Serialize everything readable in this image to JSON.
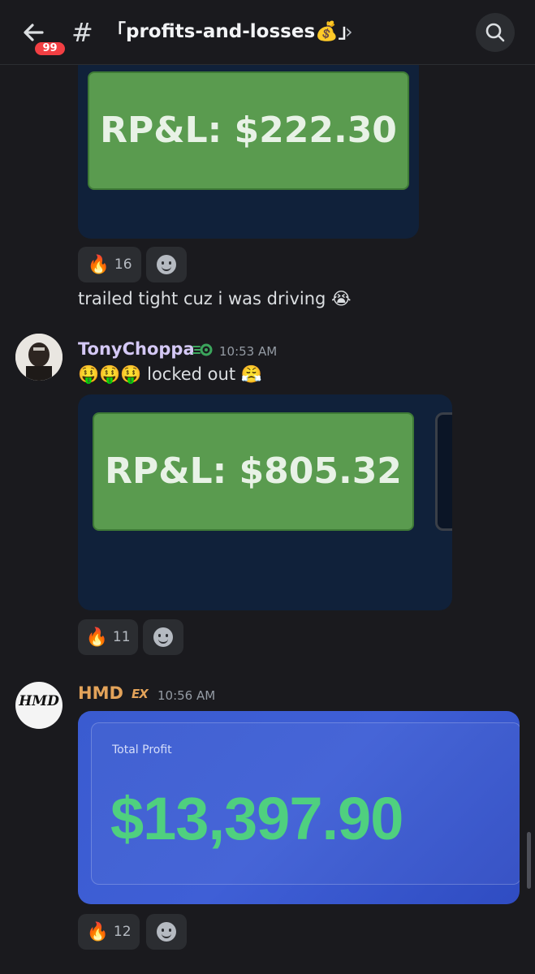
{
  "header": {
    "unread_count": "99",
    "hash": "#",
    "channel_name": "「profits-and-losses💰」",
    "chevron": "›"
  },
  "messages": [
    {
      "attachment_text": "RP&L: $222.30",
      "reaction": {
        "emoji": "🔥",
        "count": "16"
      },
      "text": "trailed tight cuz i was driving 😭"
    },
    {
      "username": "TonyChoppa",
      "username_color": "#d4c8f5",
      "time": "10:53 AM",
      "text": "🤑🤑🤑 locked out 😤",
      "attachment_text": "RP&L: $805.32",
      "reaction": {
        "emoji": "🔥",
        "count": "11"
      }
    },
    {
      "username": "HMD",
      "username_color": "#e3a35a",
      "tag": "EX",
      "time": "10:56 AM",
      "avatar_text": "HMD",
      "attachment_label": "Total Profit",
      "attachment_value": "$13,397.90",
      "reaction": {
        "emoji": "🔥",
        "count": "12"
      }
    }
  ],
  "icons": [
    "back-arrow-icon",
    "search-icon",
    "nitro-boost-icon",
    "add-reaction-icon"
  ]
}
